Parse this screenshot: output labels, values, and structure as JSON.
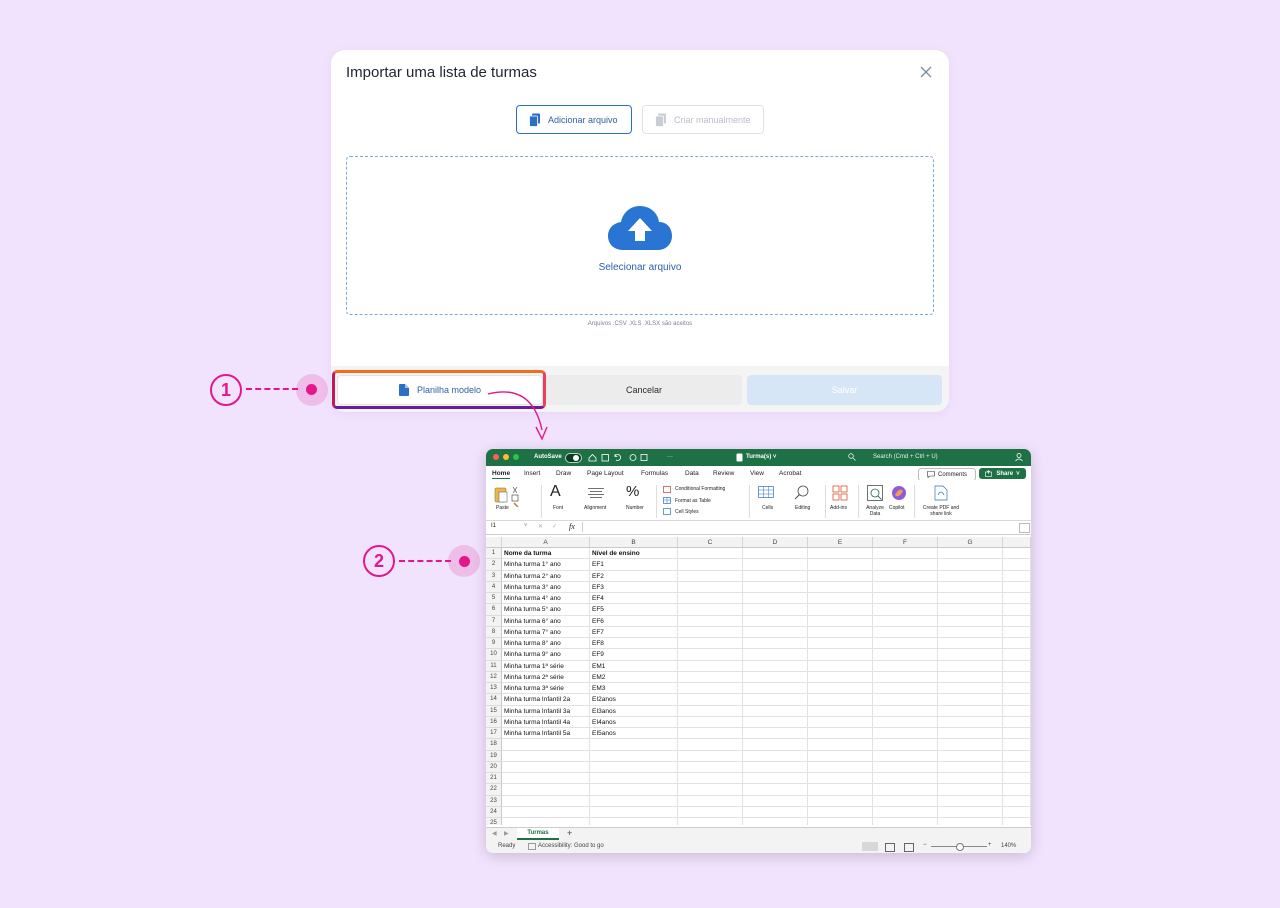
{
  "modal": {
    "title": "Importar uma lista de turmas",
    "tabs": [
      "Adicionar arquivo",
      "Criar manualmente"
    ],
    "dropzone_label": "Selecionar arquivo",
    "accepted_formats": "Arquivos .CSV .XLS .XLSX são aceitos",
    "buttons": {
      "template": "Planilha modelo",
      "cancel": "Cancelar",
      "save": "Salvar"
    }
  },
  "callouts": [
    "1",
    "2"
  ],
  "excel": {
    "autosave": "AutoSave",
    "filename": "Turma(s) ˅",
    "search": "Search (Cmd + Ctrl + U)",
    "menu": [
      "Home",
      "Insert",
      "Draw",
      "Page Layout",
      "Formulas",
      "Data",
      "Review",
      "View",
      "Acrobat"
    ],
    "comments": "Comments",
    "share": "Share",
    "ribbon": {
      "paste": "Paste",
      "font": "Font",
      "alignment": "Alignment",
      "number": "Number",
      "conditional": "Conditional Formatting",
      "format_table": "Format as Table",
      "cell_styles": "Cell Styles",
      "cells": "Cells",
      "editing": "Editing",
      "addins": "Add-ins",
      "analyze": "Analyze Data",
      "copilot": "Copilot",
      "create_pdf": "Create PDF and share link"
    },
    "name_box": "I1",
    "fx": "fx",
    "columns": [
      "A",
      "B",
      "C",
      "D",
      "E",
      "F",
      "G"
    ],
    "row_numbers": [
      "1",
      "2",
      "3",
      "4",
      "5",
      "6",
      "7",
      "8",
      "9",
      "10",
      "11",
      "12",
      "13",
      "14",
      "15",
      "16",
      "17",
      "18",
      "19",
      "20",
      "21",
      "22",
      "23",
      "24",
      "25"
    ],
    "rows": [
      [
        "Nome da turma",
        "Nível de ensino"
      ],
      [
        "Minha turma 1° ano",
        "EF1"
      ],
      [
        "Minha turma 2° ano",
        "EF2"
      ],
      [
        "Minha turma 3° ano",
        "EF3"
      ],
      [
        "Minha turma 4° ano",
        "EF4"
      ],
      [
        "Minha turma 5° ano",
        "EF5"
      ],
      [
        "Minha turma 6° ano",
        "EF6"
      ],
      [
        "Minha turma 7° ano",
        "EF7"
      ],
      [
        "Minha turma 8° ano",
        "EF8"
      ],
      [
        "Minha turma 9° ano",
        "EF9"
      ],
      [
        "Minha turma 1ª série",
        "EM1"
      ],
      [
        "Minha turma 2ª série",
        "EM2"
      ],
      [
        "Minha turma 3ª série",
        "EM3"
      ],
      [
        "Minha turma Infantil 2a",
        "EI2anos"
      ],
      [
        "Minha turma Infantil 3a",
        "EI3anos"
      ],
      [
        "Minha turma Infantil 4a",
        "EI4anos"
      ],
      [
        "Minha turma Infantil 5a",
        "EI5anos"
      ]
    ],
    "sheet_tab": "Turmas",
    "add_sheet": "+",
    "status": "Ready",
    "accessibility": "Accessibility: Good to go",
    "zoom": "140%"
  },
  "colors": {
    "accent": "#2d6fc4",
    "excel_green": "#1e7145",
    "callout": "#e5168c",
    "background": "#f1e3fd"
  }
}
